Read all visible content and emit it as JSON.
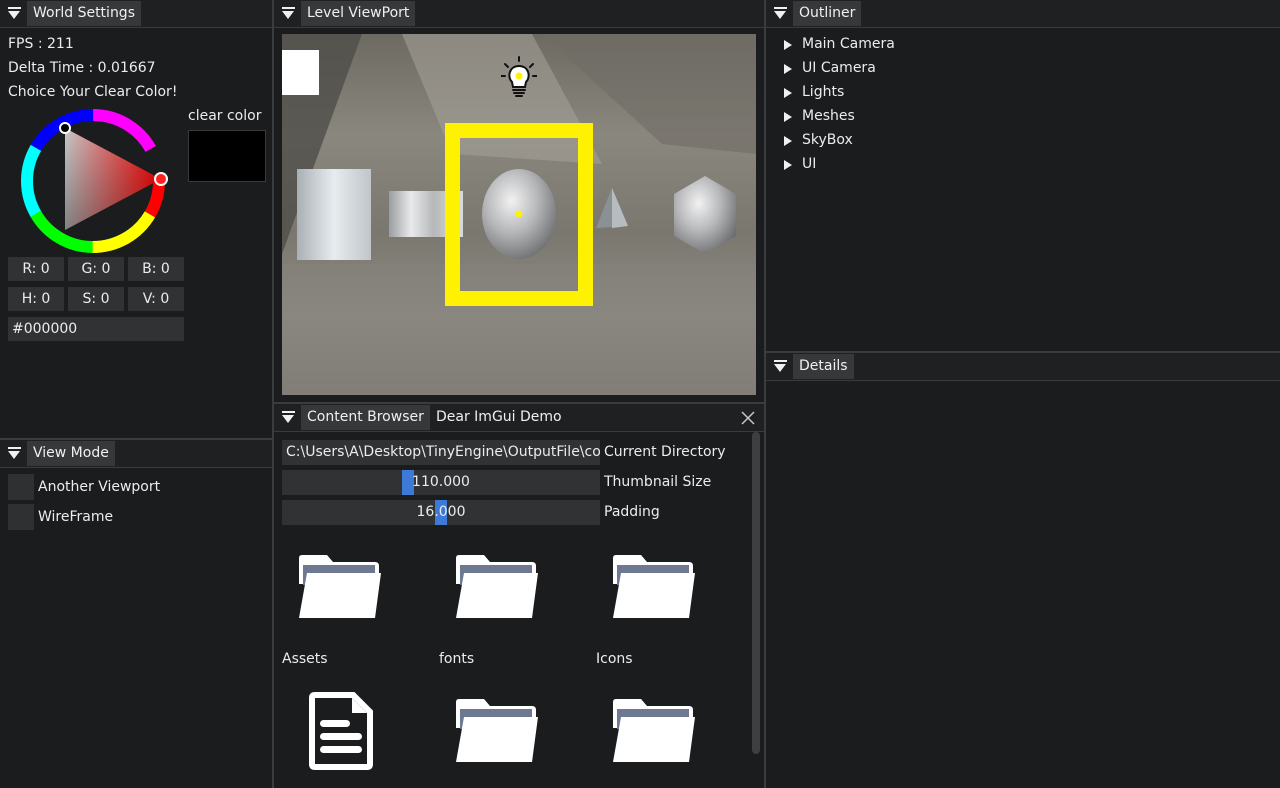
{
  "world_settings": {
    "tab": "World Settings",
    "fps": "FPS : 211",
    "delta_time": "Delta Time : 0.01667",
    "choice_label": "Choice Your Clear Color!",
    "clear_color_label": "clear color",
    "r": "R: 0",
    "g": "G: 0",
    "b": "B: 0",
    "h": "H: 0",
    "s": "S: 0",
    "v": "V: 0",
    "hex": "#000000",
    "clear_color_value": "#000000"
  },
  "view_mode": {
    "tab": "View Mode",
    "options": [
      "Another Viewport",
      "WireFrame"
    ]
  },
  "level_viewport": {
    "tab": "Level ViewPort",
    "selection_color": "#fff200"
  },
  "content_browser": {
    "tabs": [
      "Content Browser",
      "Dear ImGui Demo"
    ],
    "directory_value": "C:\\Users\\A\\Desktop\\TinyEngine\\OutputFile\\co",
    "directory_label": "Current Directory",
    "thumbnail_value": "110.000",
    "thumbnail_label": "Thumbnail Size",
    "padding_value": "16.000",
    "padding_label": "Padding",
    "items": [
      {
        "name": "Assets",
        "icon": "folder-icon"
      },
      {
        "name": "fonts",
        "icon": "folder-icon"
      },
      {
        "name": "Icons",
        "icon": "folder-icon"
      },
      {
        "name": "",
        "icon": "file-icon"
      },
      {
        "name": "",
        "icon": "folder-icon"
      },
      {
        "name": "",
        "icon": "folder-icon"
      }
    ]
  },
  "outliner": {
    "tab": "Outliner",
    "items": [
      "Main Camera",
      "UI Camera",
      "Lights",
      "Meshes",
      "SkyBox",
      "UI"
    ]
  },
  "details": {
    "tab": "Details"
  },
  "colors": {
    "accent": "#3d7ad8",
    "panel_bg": "#1b1c1d",
    "tab_bg": "#36383a",
    "frame_bg": "#303234"
  }
}
